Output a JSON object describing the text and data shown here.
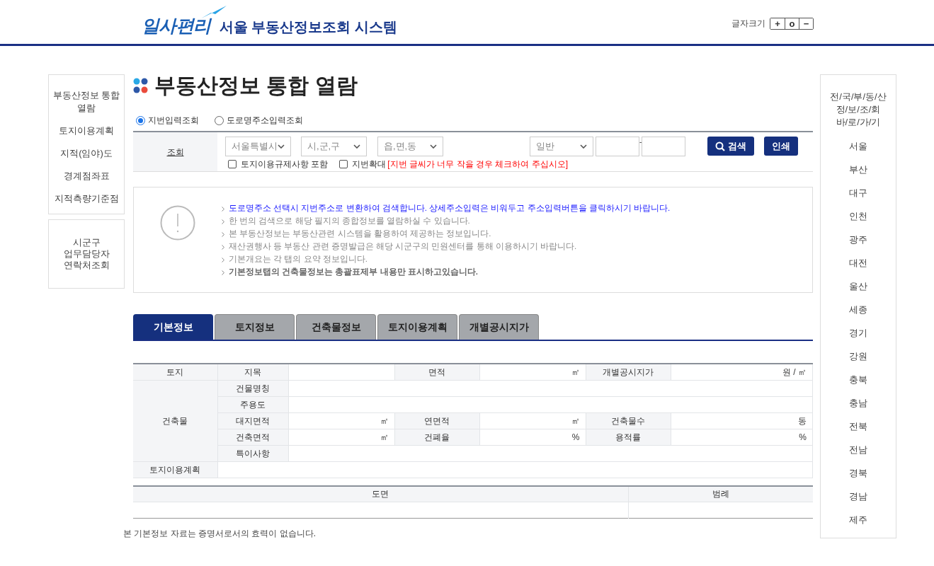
{
  "header": {
    "logo": "일사편리",
    "title": "서울 부동산정보조회 시스템",
    "font_size_label": "글자크기",
    "font_size_buttons": [
      "+",
      "o",
      "−"
    ]
  },
  "left_menu": [
    {
      "label": "부동산정보 통합 열람"
    },
    {
      "label": "토지이용계획"
    },
    {
      "label": "지적(임야)도"
    },
    {
      "label": "경계점좌표"
    },
    {
      "label": "지적측량기준점"
    }
  ],
  "contact_link": "시군구 업무담당자 연락처조회",
  "page_title": "부동산정보 통합 열람",
  "search": {
    "radios": [
      {
        "label": "지번입력조회",
        "selected": true
      },
      {
        "label": "도로명주소입력조회",
        "selected": false
      }
    ],
    "label": "조회",
    "selects": [
      {
        "value": "서울특별시"
      },
      {
        "value": "시,군,구"
      },
      {
        "value": "읍,면,동"
      },
      {
        "value": "일반"
      }
    ],
    "separator": "-",
    "checkboxes": [
      {
        "label": "토지이용규제사항 포함",
        "checked": false
      },
      {
        "label": "지번확대",
        "checked": false,
        "note": "[지번 글씨가 너무 작을 경우 체크하여 주십시오]"
      }
    ],
    "buttons": [
      {
        "label": "검색",
        "kind": "search"
      },
      {
        "label": "인쇄",
        "kind": "plain"
      }
    ]
  },
  "notice": [
    {
      "text": "도로명주소 선택시 지번주소로 변환하여 검색합니다. 상세주소입력은 비워두고 주소입력버튼을 클릭하시기 바랍니다.",
      "kind": "highlight"
    },
    {
      "text": "한 번의 검색으로 해당 필지의 종합정보를 열람하실 수 있습니다.",
      "kind": "normal"
    },
    {
      "text": "본 부동산정보는 부동산관련 시스템을 활용하여 제공하는 정보입니다.",
      "kind": "normal"
    },
    {
      "text": "재산권행사 등 부동산 관련 증명발급은 해당 시군구의 민원센터를 통해 이용하시기 바랍니다.",
      "kind": "normal"
    },
    {
      "text": "기본개요는 각 탭의 요약 정보입니다.",
      "kind": "normal"
    },
    {
      "text": "기본정보탭의 건축물정보는 총괄표제부 내용만 표시하고있습니다.",
      "kind": "bold"
    }
  ],
  "tabs": [
    {
      "label": "기본정보",
      "selected": true
    },
    {
      "label": "토지정보",
      "selected": false
    },
    {
      "label": "건축물정보",
      "selected": false
    },
    {
      "label": "토지이용계획",
      "selected": false
    },
    {
      "label": "개별공시지가",
      "selected": false
    }
  ],
  "info_table": [
    [
      {
        "kind": "label",
        "text": "토지"
      },
      {
        "kind": "label",
        "text": "지목"
      },
      {
        "kind": "value"
      },
      {
        "kind": "label",
        "text": "면적"
      },
      {
        "kind": "value",
        "text": "㎡"
      },
      {
        "kind": "label",
        "text": "개별공시지가"
      },
      {
        "kind": "value",
        "text": "원 / ㎡"
      }
    ],
    [
      {
        "kind": "group",
        "text": "건축물"
      },
      {
        "kind": "label",
        "text": "건물명칭"
      },
      {
        "kind": "wide"
      }
    ],
    [
      {
        "kind": "label",
        "text": "주용도"
      },
      {
        "kind": "wide"
      }
    ],
    [
      {
        "kind": "label",
        "text": "대지면적"
      },
      {
        "kind": "value",
        "text": "㎡"
      },
      {
        "kind": "label",
        "text": "연면적"
      },
      {
        "kind": "value",
        "text": "㎡"
      },
      {
        "kind": "label",
        "text": "건축물수"
      },
      {
        "kind": "value",
        "text": "동"
      }
    ],
    [
      {
        "kind": "label",
        "text": "건축면적"
      },
      {
        "kind": "value",
        "text": "㎡"
      },
      {
        "kind": "label",
        "text": "건폐율"
      },
      {
        "kind": "value",
        "text": "%"
      },
      {
        "kind": "label",
        "text": "용적률"
      },
      {
        "kind": "value",
        "text": "%"
      }
    ],
    [
      {
        "kind": "label",
        "text": "특이사항"
      },
      {
        "kind": "wide"
      }
    ],
    [
      {
        "kind": "label",
        "text": "토지이용계획"
      },
      {
        "kind": "wide"
      }
    ]
  ],
  "map_table": {
    "columns": [
      "도면",
      "범례"
    ]
  },
  "footnote": "본 기본정보 자료는 증명서로서의 효력이 없습니다.",
  "right_menu": {
    "heading": [
      "전/국/부/동/산",
      "정/보/조/회",
      "바/로/가/기"
    ],
    "items": [
      "서울",
      "부산",
      "대구",
      "인천",
      "광주",
      "대전",
      "울산",
      "세종",
      "경기",
      "강원",
      "충북",
      "충남",
      "전북",
      "전남",
      "경북",
      "경남",
      "제주"
    ]
  }
}
